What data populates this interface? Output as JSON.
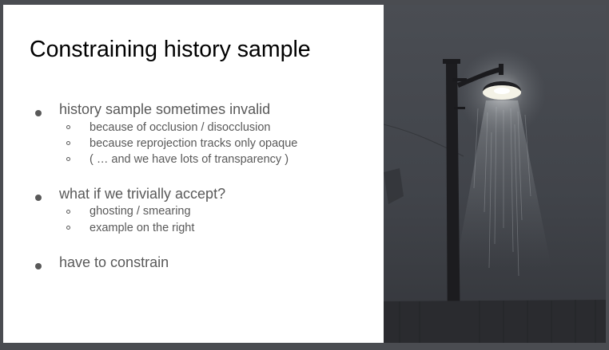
{
  "slide": {
    "title": "Constraining history sample",
    "bullets": [
      {
        "text": "history sample sometimes invalid",
        "sub": [
          "because of occlusion / disocclusion",
          "because reprojection tracks only opaque",
          "( … and we have lots of transparency )"
        ]
      },
      {
        "text": "what if we trivially accept?",
        "sub": [
          "ghosting / smearing",
          "example on the right"
        ]
      },
      {
        "text": "have to constrain",
        "sub": []
      }
    ]
  },
  "image": {
    "subject": "street-lamp-with-light-rain",
    "colors": {
      "sky_top": "#474a50",
      "sky_bottom": "#35373c",
      "pole": "#1c1c1f",
      "lamp_glow": "#f4f2e6",
      "fence": "#2a2b2f"
    }
  }
}
